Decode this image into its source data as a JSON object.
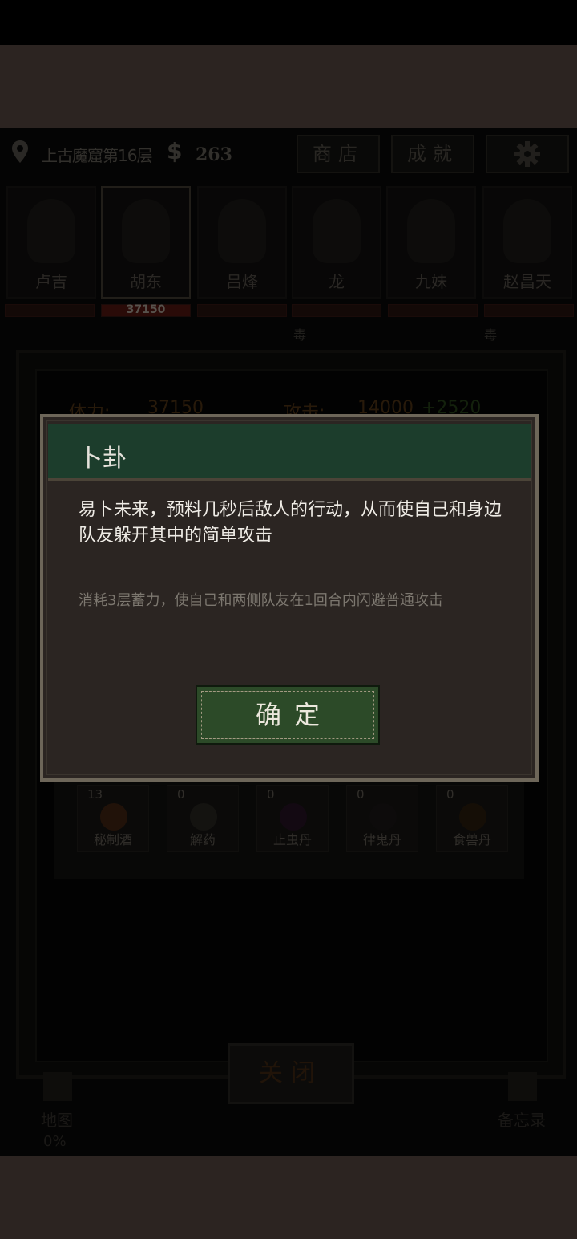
{
  "header": {
    "location": "上古魔窟第16层",
    "money_symbol": "$",
    "money": "263",
    "shop_label": "商店",
    "achievements_label": "成就"
  },
  "heroes": [
    {
      "name": "卢吉",
      "hp": ""
    },
    {
      "name": "胡东",
      "hp": "37150"
    },
    {
      "name": "吕烽",
      "hp": ""
    },
    {
      "name": "龙",
      "hp": ""
    },
    {
      "name": "九妹",
      "hp": ""
    },
    {
      "name": "赵昌天",
      "hp": ""
    }
  ],
  "status_tag": "毒",
  "stats": {
    "hp_label": "体力:",
    "hp_value": "37150",
    "atk_label": "攻击:",
    "atk_value": "14000",
    "atk_bonus": "+2520"
  },
  "items": [
    {
      "count": "13",
      "name": "秘制酒",
      "color": "#6a3a1e"
    },
    {
      "count": "0",
      "name": "解药",
      "color": "#4a4639"
    },
    {
      "count": "0",
      "name": "止虫丹",
      "color": "#3e1f3a"
    },
    {
      "count": "0",
      "name": "律鬼丹",
      "color": "#2a2624"
    },
    {
      "count": "0",
      "name": "食兽丹",
      "color": "#4a2e18"
    }
  ],
  "close_label": "关闭",
  "bottom_nav": {
    "map_label": "地图",
    "map_progress": "0%",
    "memo_label": "备忘录"
  },
  "modal": {
    "title": "卜卦",
    "description": "易卜未来，预料几秒后敌人的行动，从而使自己和身边队友躲开其中的简单攻击",
    "effect": "消耗3层蓄力，使自己和两侧队友在1回合内闪避普通攻击",
    "confirm_label": "确定"
  },
  "colors": {
    "modal_header": "#1c3d2c",
    "confirm_button": "#2c4a28",
    "hp_bar": "#5e1a12"
  }
}
